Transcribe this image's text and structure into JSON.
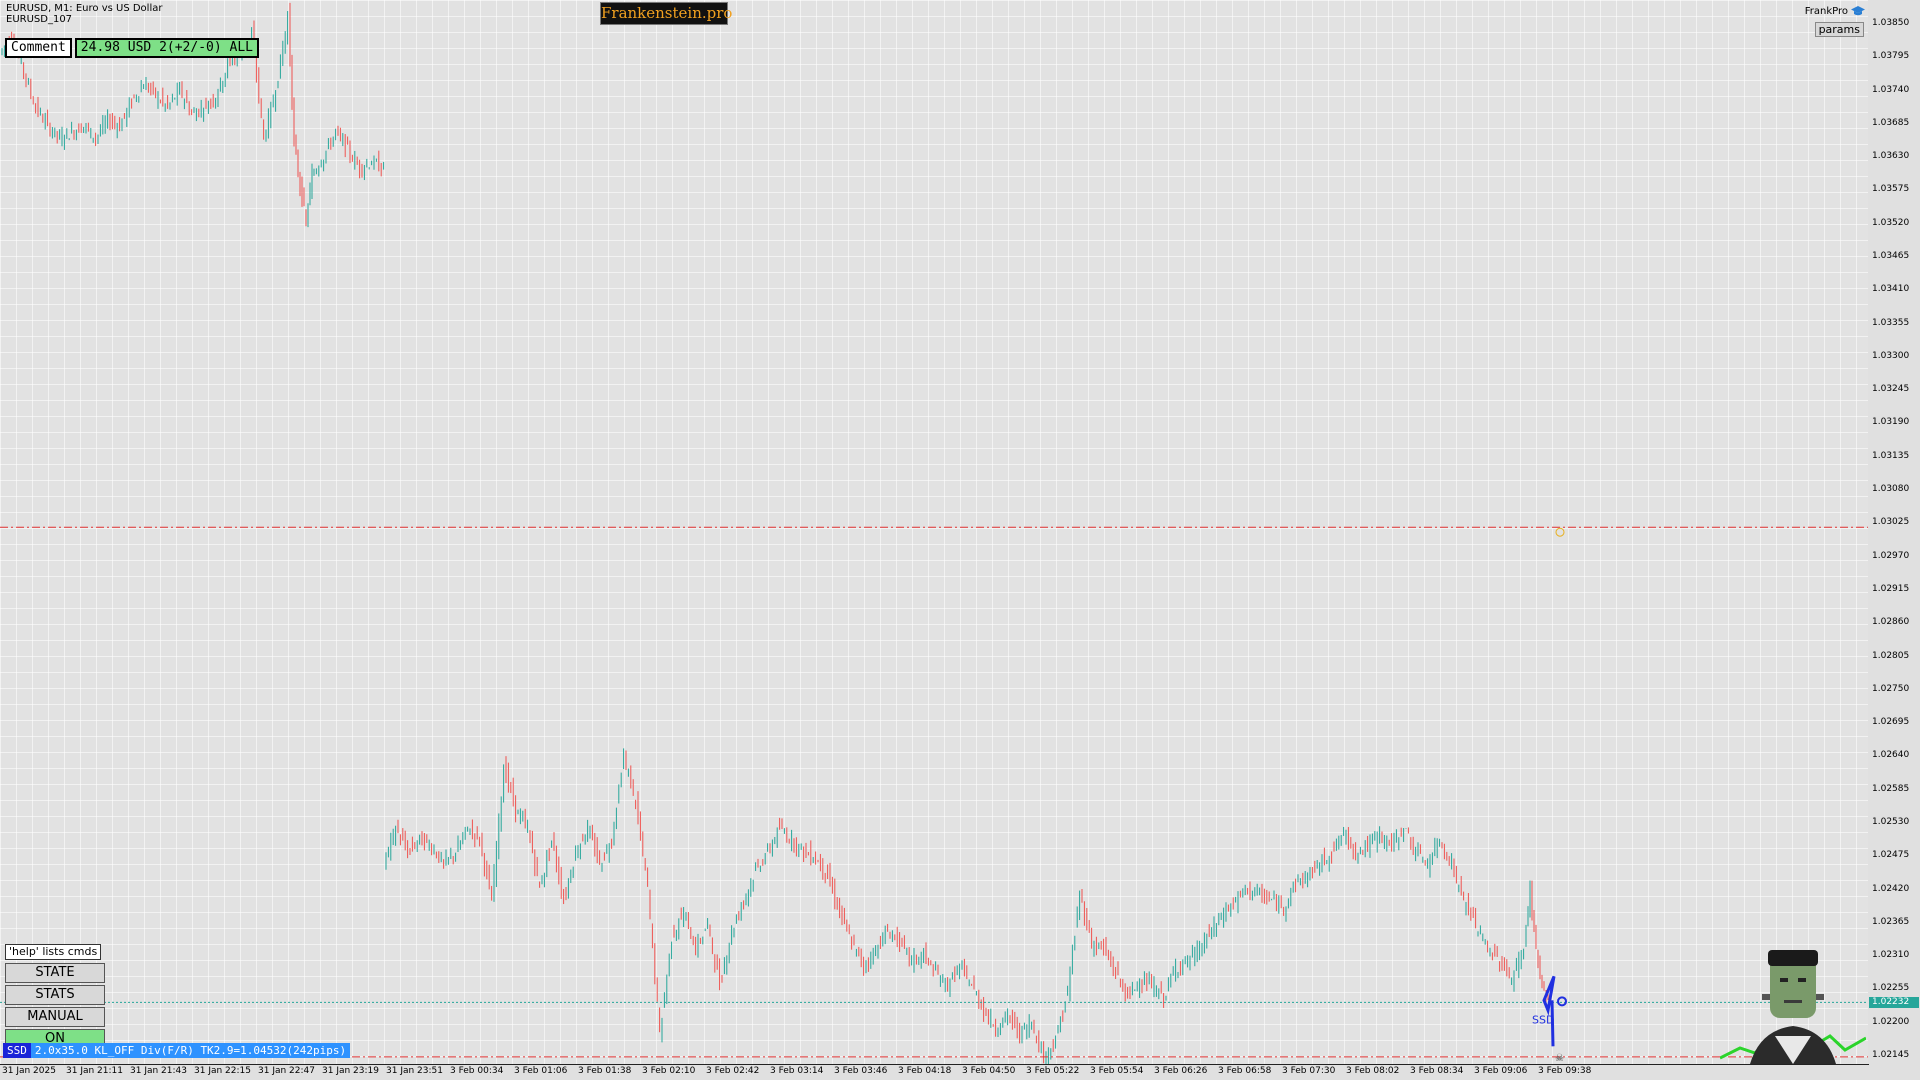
{
  "header": {
    "symbol_line": "EURUSD, M1:  Euro vs US Dollar",
    "account_line": "EURUSD_107",
    "brand": "Frankenstein.pro",
    "frankpro_label": "FrankPro",
    "params_label": "params"
  },
  "comment": {
    "label": "Comment",
    "value": "24.98 USD 2(+2/-0) ALL"
  },
  "side_panel": {
    "help": "'help' lists cmds",
    "buttons": [
      "STATE",
      "STATS",
      "MANUAL",
      "ON"
    ]
  },
  "status_bar": {
    "tag": "SSD",
    "text": "2.0x35.0 KL_OFF Div(F/R) TK2.9=1.04532(242pips)"
  },
  "annotations": {
    "ssd_label": "SSD"
  },
  "price_axis": {
    "ticks": [
      "1.03850",
      "1.03795",
      "1.03740",
      "1.03685",
      "1.03630",
      "1.03575",
      "1.03520",
      "1.03465",
      "1.03410",
      "1.03355",
      "1.03300",
      "1.03245",
      "1.03190",
      "1.03135",
      "1.03080",
      "1.03025",
      "1.02970",
      "1.02915",
      "1.02860",
      "1.02805",
      "1.02750",
      "1.02695",
      "1.02640",
      "1.02585",
      "1.02530",
      "1.02475",
      "1.02420",
      "1.02365",
      "1.02310",
      "1.02255",
      "1.02200",
      "1.02145"
    ],
    "current_price": "1.02232"
  },
  "time_axis": {
    "ticks": [
      "31 Jan 2025",
      "31 Jan 21:11",
      "31 Jan 21:43",
      "31 Jan 22:15",
      "31 Jan 22:47",
      "31 Jan 23:19",
      "31 Jan 23:51",
      "3 Feb 00:34",
      "3 Feb 01:06",
      "3 Feb 01:38",
      "3 Feb 02:10",
      "3 Feb 02:42",
      "3 Feb 03:14",
      "3 Feb 03:46",
      "3 Feb 04:18",
      "3 Feb 04:50",
      "3 Feb 05:22",
      "3 Feb 05:54",
      "3 Feb 06:26",
      "3 Feb 06:58",
      "3 Feb 07:30",
      "3 Feb 08:02",
      "3 Feb 08:34",
      "3 Feb 09:06",
      "3 Feb 09:38"
    ]
  },
  "chart_data": {
    "type": "candlestick",
    "symbol": "EURUSD",
    "timeframe": "M1",
    "y_range": [
      1.0212,
      1.0388
    ],
    "grid": true,
    "up_color": "#26a69a",
    "down_color": "#ef5350",
    "bg_color": "#e2e2e2",
    "levels": [
      {
        "kind": "dash-dot",
        "color": "#e03030",
        "price": 1.03017
      },
      {
        "kind": "dash-dot",
        "color": "#e03030",
        "price": 1.02142
      },
      {
        "kind": "dotted",
        "color": "#26a69a",
        "price": 1.02232
      }
    ],
    "close_path_segments": [
      [
        [
          0,
          1.038
        ],
        [
          10,
          1.0383
        ],
        [
          20,
          1.0377
        ],
        [
          30,
          1.0371
        ],
        [
          40,
          1.0368
        ],
        [
          50,
          1.0366
        ],
        [
          60,
          1.0367
        ],
        [
          70,
          1.0368
        ],
        [
          80,
          1.0366
        ],
        [
          90,
          1.0369
        ],
        [
          100,
          1.0368
        ],
        [
          110,
          1.0372
        ],
        [
          120,
          1.0375
        ],
        [
          130,
          1.0373
        ],
        [
          140,
          1.0371
        ],
        [
          150,
          1.0374
        ],
        [
          160,
          1.037
        ],
        [
          170,
          1.0371
        ],
        [
          180,
          1.0373
        ],
        [
          190,
          1.0378
        ],
        [
          200,
          1.038
        ],
        [
          210,
          1.0383
        ],
        [
          220,
          1.0366
        ],
        [
          230,
          1.0374
        ],
        [
          240,
          1.0386
        ],
        [
          245,
          1.0365
        ],
        [
          250,
          1.0358
        ],
        [
          255,
          1.0352
        ],
        [
          260,
          1.036
        ],
        [
          270,
          1.0363
        ],
        [
          280,
          1.0367
        ],
        [
          290,
          1.0364
        ],
        [
          300,
          1.0361
        ],
        [
          310,
          1.0362
        ],
        [
          320,
          1.0361
        ]
      ],
      [
        [
          320,
          1.0246
        ],
        [
          330,
          1.0252
        ],
        [
          340,
          1.0248
        ],
        [
          350,
          1.025
        ],
        [
          360,
          1.0249
        ],
        [
          370,
          1.0246
        ],
        [
          380,
          1.0248
        ],
        [
          390,
          1.0252
        ],
        [
          400,
          1.025
        ],
        [
          410,
          1.024
        ],
        [
          420,
          1.0262
        ],
        [
          430,
          1.0255
        ],
        [
          440,
          1.0252
        ],
        [
          450,
          1.0242
        ],
        [
          460,
          1.025
        ],
        [
          470,
          1.024
        ],
        [
          480,
          1.0248
        ],
        [
          490,
          1.0252
        ],
        [
          500,
          1.0246
        ],
        [
          510,
          1.025
        ],
        [
          520,
          1.0264
        ],
        [
          530,
          1.0256
        ],
        [
          540,
          1.0242
        ],
        [
          550,
          1.0218
        ],
        [
          560,
          1.0234
        ],
        [
          570,
          1.0238
        ],
        [
          580,
          1.0232
        ],
        [
          590,
          1.0236
        ],
        [
          600,
          1.0226
        ],
        [
          610,
          1.0235
        ],
        [
          620,
          1.024
        ],
        [
          630,
          1.0245
        ],
        [
          640,
          1.0248
        ],
        [
          650,
          1.0252
        ],
        [
          660,
          1.025
        ],
        [
          670,
          1.0248
        ],
        [
          680,
          1.0247
        ],
        [
          690,
          1.0244
        ],
        [
          700,
          1.0238
        ],
        [
          710,
          1.0233
        ],
        [
          720,
          1.0229
        ],
        [
          730,
          1.0232
        ],
        [
          740,
          1.0235
        ],
        [
          750,
          1.0233
        ],
        [
          760,
          1.023
        ],
        [
          770,
          1.0231
        ],
        [
          780,
          1.0228
        ],
        [
          790,
          1.0226
        ],
        [
          800,
          1.0229
        ],
        [
          810,
          1.0226
        ],
        [
          820,
          1.0222
        ],
        [
          830,
          1.0219
        ],
        [
          840,
          1.0221
        ],
        [
          850,
          1.0218
        ],
        [
          860,
          1.022
        ],
        [
          870,
          1.0214
        ],
        [
          880,
          1.0217
        ],
        [
          890,
          1.0225
        ],
        [
          900,
          1.0241
        ],
        [
          910,
          1.0233
        ],
        [
          920,
          1.0232
        ],
        [
          930,
          1.0228
        ],
        [
          940,
          1.0224
        ],
        [
          950,
          1.0227
        ],
        [
          960,
          1.0226
        ],
        [
          970,
          1.0224
        ],
        [
          980,
          1.0229
        ],
        [
          990,
          1.023
        ],
        [
          1000,
          1.0232
        ],
        [
          1010,
          1.0235
        ],
        [
          1020,
          1.0238
        ],
        [
          1030,
          1.024
        ],
        [
          1040,
          1.0242
        ],
        [
          1050,
          1.0241
        ],
        [
          1060,
          1.024
        ],
        [
          1070,
          1.0239
        ],
        [
          1080,
          1.0243
        ],
        [
          1090,
          1.0244
        ],
        [
          1100,
          1.0246
        ],
        [
          1110,
          1.0248
        ],
        [
          1120,
          1.0251
        ],
        [
          1130,
          1.0248
        ],
        [
          1140,
          1.0249
        ],
        [
          1150,
          1.0251
        ],
        [
          1160,
          1.0249
        ],
        [
          1170,
          1.0252
        ],
        [
          1180,
          1.0248
        ],
        [
          1190,
          1.0246
        ],
        [
          1200,
          1.025
        ],
        [
          1210,
          1.0246
        ],
        [
          1220,
          1.024
        ],
        [
          1230,
          1.0236
        ],
        [
          1240,
          1.0232
        ],
        [
          1250,
          1.023
        ],
        [
          1260,
          1.0227
        ],
        [
          1270,
          1.0232
        ],
        [
          1275,
          1.0242
        ],
        [
          1280,
          1.0232
        ],
        [
          1285,
          1.0226
        ],
        [
          1290,
          1.0223
        ]
      ]
    ]
  }
}
